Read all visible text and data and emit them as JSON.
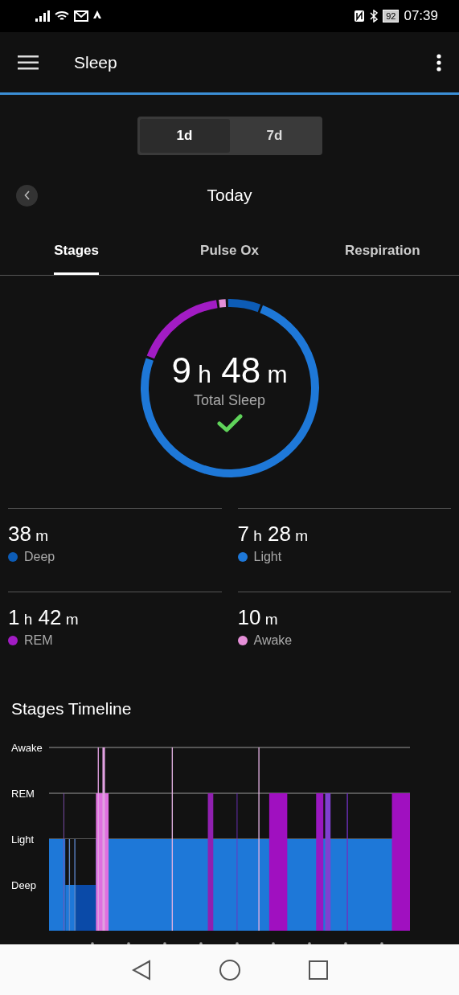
{
  "status_bar": {
    "battery": "92",
    "time": "07:39"
  },
  "header": {
    "title": "Sleep"
  },
  "range_toggle": [
    {
      "label": "1d",
      "selected": true
    },
    {
      "label": "7d",
      "selected": false
    }
  ],
  "date_nav": {
    "label": "Today"
  },
  "tabs": [
    {
      "label": "Stages",
      "selected": true
    },
    {
      "label": "Pulse Ox",
      "selected": false
    },
    {
      "label": "Respiration",
      "selected": false
    }
  ],
  "summary": {
    "value": "9 h 48 m",
    "label": "Total Sleep"
  },
  "stats": [
    {
      "value": "38 m",
      "label": "Deep",
      "color": "#0d5cb6"
    },
    {
      "value": "7 h 28 m",
      "label": "Light",
      "color": "#1e78d8"
    },
    {
      "value": "1 h 42 m",
      "label": "REM",
      "color": "#a21cc4"
    },
    {
      "value": "10 m",
      "label": "Awake",
      "color": "#e58fd8"
    }
  ],
  "timeline": {
    "title": "Stages Timeline",
    "levels": [
      "Awake",
      "REM",
      "Light",
      "Deep"
    ]
  }
}
